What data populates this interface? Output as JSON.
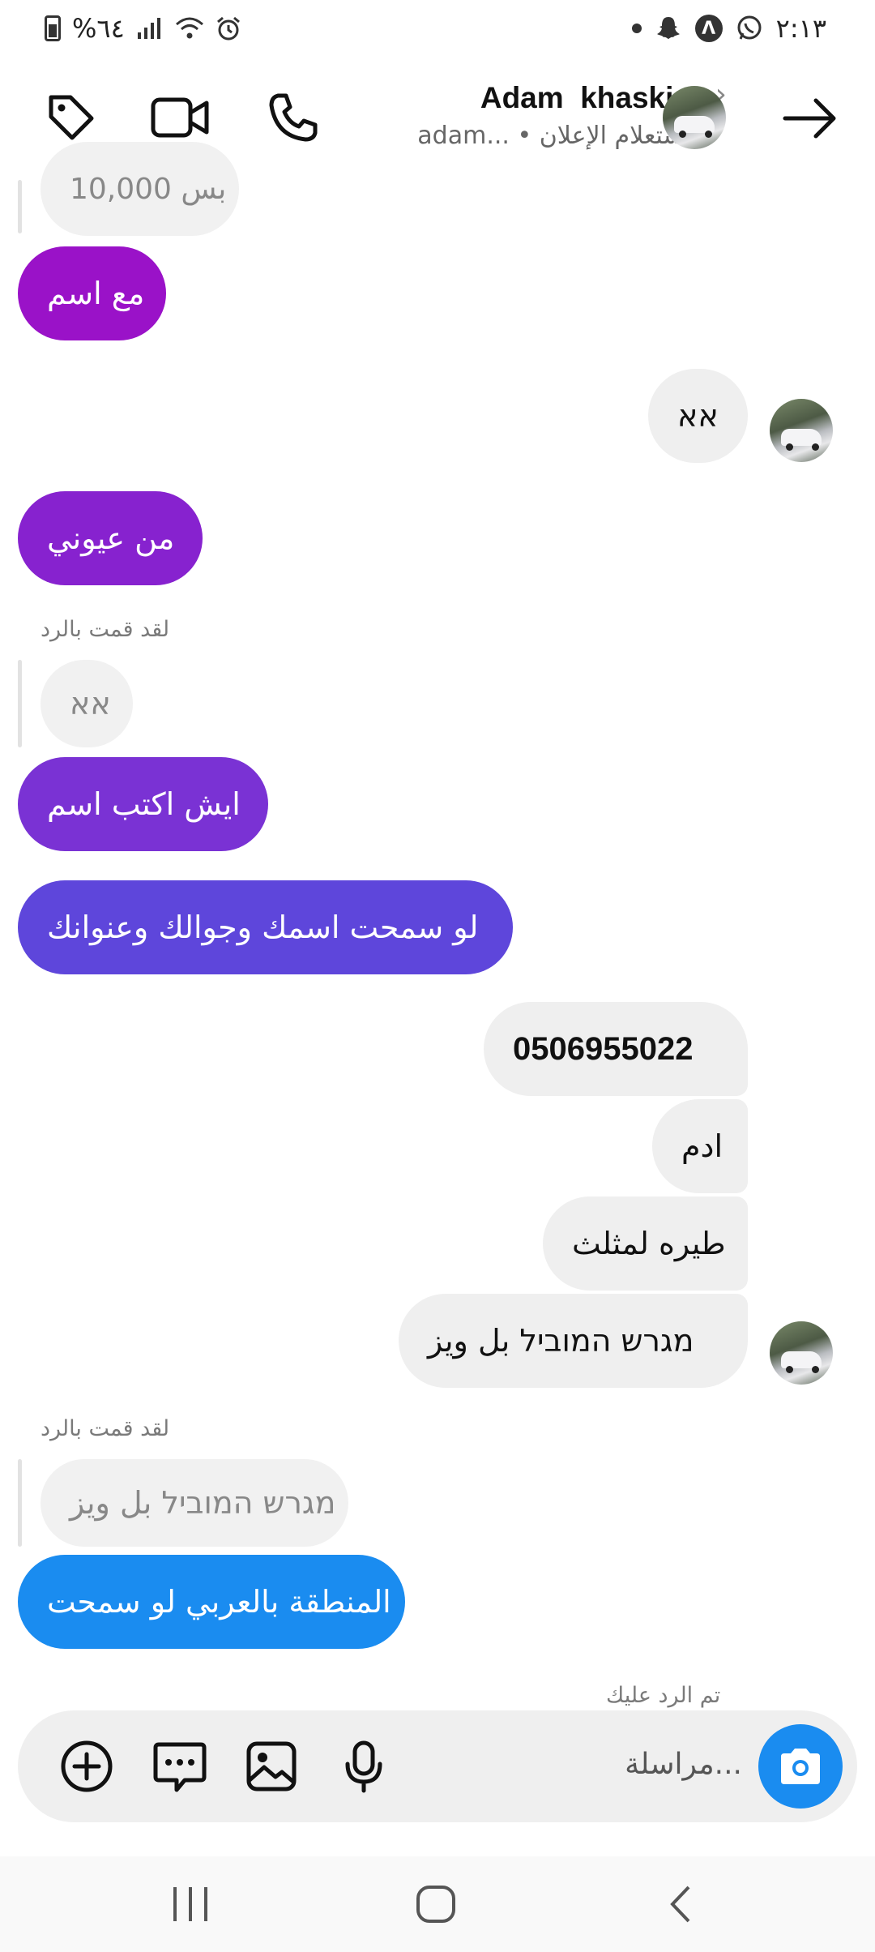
{
  "status_bar": {
    "battery_percent": "%٦٤",
    "time": "٢:١٣"
  },
  "header": {
    "contact_name": "Adam  khaskia",
    "subtitle": "adam... • استعلام الإعلان"
  },
  "messages": {
    "m0": "بس 10,000",
    "m1": "مع اسم",
    "m2": "אא",
    "m3": "من عيوني",
    "reply_label_1": "لقد قمت بالرد",
    "m4_quote": "אא",
    "m5": "ايش اكتب اسم",
    "m6": "لو سمحت اسمك وجوالك وعنوانك",
    "m7": "0506955022",
    "m8": "ادم",
    "m9": "طيره لمثلث",
    "m10": "מגרש המוביל بل ويز",
    "reply_label_2": "لقد قمت بالرد",
    "m11_quote": "מגרש המוביל بل ويز",
    "m12": "المنطقة بالعربي لو سمحت",
    "replied_to_you": "تم الرد عليك"
  },
  "composer": {
    "placeholder": "مراسلة..."
  },
  "colors": {
    "grad_top": "#9a12c8",
    "grad_mid": "#6a3fd6",
    "grad_bot": "#1a8cf0",
    "out_bubble": "#efefef",
    "camera": "#1a8cf0"
  },
  "icons": [
    "tag-icon",
    "video-call-icon",
    "phone-icon",
    "chevron-right-icon",
    "back-arrow-icon",
    "plus-icon",
    "sticker-icon",
    "gallery-icon",
    "microphone-icon",
    "camera-icon"
  ]
}
